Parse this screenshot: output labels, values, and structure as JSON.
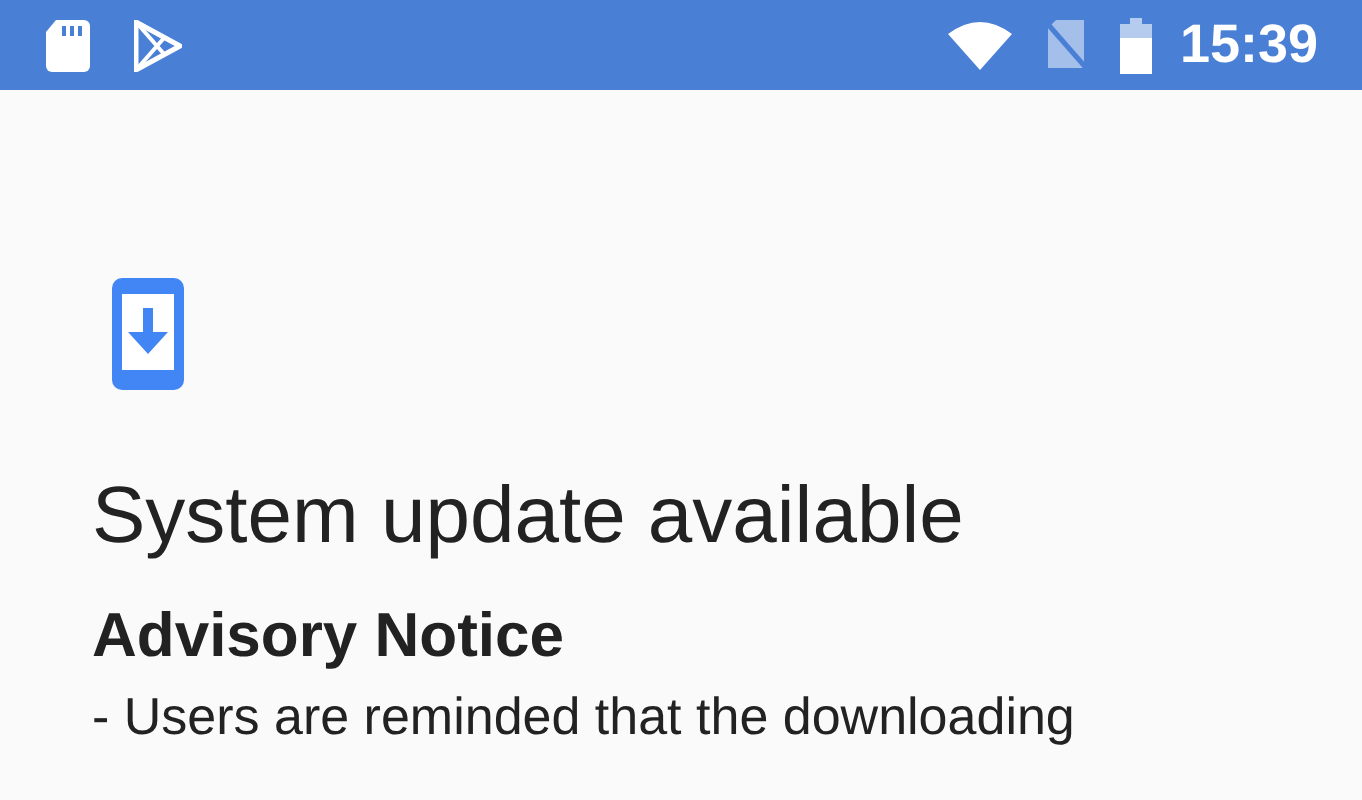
{
  "status_bar": {
    "time": "15:39"
  },
  "title": "System update available",
  "notice": {
    "heading": "Advisory Notice",
    "body": "- Users are reminded that the downloading"
  }
}
